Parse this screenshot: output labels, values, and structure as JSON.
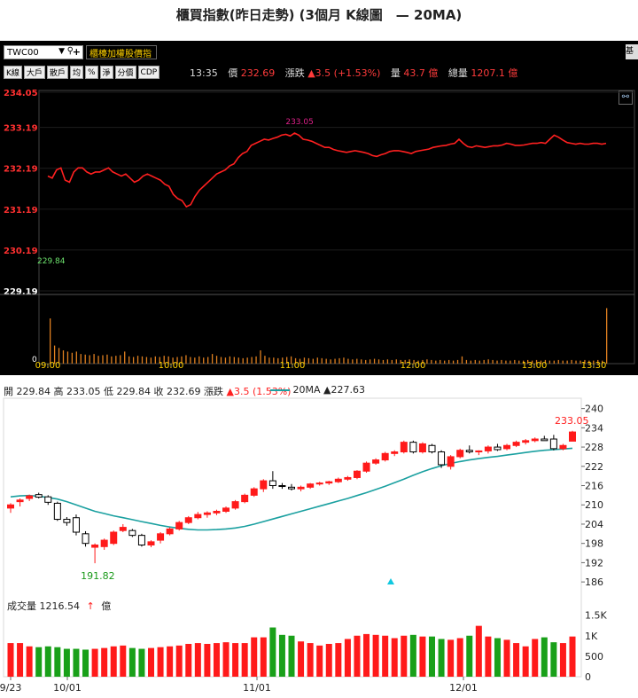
{
  "page_title": "櫃買指數(昨日走勢) (3個月 K線圖　— 20MA)",
  "toolbar": {
    "symbol": "TWC00",
    "index_name": "櫃檯加權股價指",
    "corner_label": "基"
  },
  "tabs": [
    "K線",
    "大戶",
    "散戶",
    "均",
    "%",
    "淨",
    "分價",
    "CDP"
  ],
  "quote": {
    "time": "13:35",
    "price_label": "價",
    "price": "232.69",
    "change_label": "漲跌",
    "change": "▲3.5 (+1.53%)",
    "volume_label": "量",
    "volume": "43.7 億",
    "total_label": "總量",
    "total": "1207.1 億"
  },
  "ohlc": {
    "open_label": "開",
    "open": "229.84",
    "high_label": "高",
    "high": "233.05",
    "low_label": "低",
    "low": "229.84",
    "close_label": "收",
    "close": "232.69",
    "change_label": "漲跌",
    "change": "▲3.5 (1.53%)"
  },
  "ma_legend": {
    "name": "20MA",
    "value": "▲227.63"
  },
  "volume_info": {
    "label": "成交量",
    "value": "1216.54",
    "arrow": "↑",
    "unit": "億"
  },
  "colors": {
    "up": "#ff1a1a",
    "down": "#19a019",
    "ma": "#1aa0a0",
    "intraday_line": "#ff2020",
    "intraday_volume": "#e08020"
  },
  "chart_data": [
    {
      "type": "line",
      "title": "intraday",
      "x_ticks": [
        "09:00",
        "10:00",
        "11:00",
        "12:00",
        "13:00",
        "13:30"
      ],
      "y_ticks": [
        "234.05",
        "233.19",
        "232.19",
        "231.19",
        "230.19",
        "229.19"
      ],
      "ylim": [
        229.19,
        234.05
      ],
      "prev_close_label": "229.84",
      "high_label": "233.05",
      "volume_zero_label": "0",
      "series": [
        {
          "values": [
            232.0,
            231.95,
            232.15,
            232.2,
            231.9,
            231.85,
            232.1,
            232.2,
            232.2,
            232.1,
            232.05,
            232.1,
            232.1,
            232.15,
            232.2,
            232.1,
            232.05,
            232.0,
            232.05,
            231.95,
            231.85,
            231.9,
            232.0,
            232.05,
            232.0,
            231.95,
            231.9,
            231.8,
            231.75,
            231.55,
            231.45,
            231.4,
            231.25,
            231.3,
            231.5,
            231.65,
            231.75,
            231.85,
            231.95,
            232.05,
            232.1,
            232.15,
            232.25,
            232.3,
            232.45,
            232.55,
            232.6,
            232.75,
            232.8,
            232.85,
            232.9,
            232.88,
            232.92,
            232.95,
            233.0,
            233.02,
            232.98,
            233.05,
            233.0,
            232.9,
            232.88,
            232.85,
            232.8,
            232.75,
            232.7,
            232.7,
            232.65,
            232.62,
            232.6,
            232.58,
            232.6,
            232.62,
            232.6,
            232.58,
            232.55,
            232.5,
            232.48,
            232.52,
            232.55,
            232.6,
            232.62,
            232.62,
            232.6,
            232.58,
            232.55,
            232.6,
            232.62,
            232.64,
            232.66,
            232.7,
            232.72,
            232.74,
            232.75,
            232.78,
            232.8,
            232.9,
            232.8,
            232.72,
            232.7,
            232.74,
            232.72,
            232.7,
            232.72,
            232.74,
            232.74,
            232.76,
            232.8,
            232.78,
            232.75,
            232.75,
            232.76,
            232.78,
            232.8,
            232.8,
            232.82,
            232.8,
            232.9,
            233.0,
            232.95,
            232.88,
            232.82,
            232.8,
            232.78,
            232.8,
            232.78,
            232.78,
            232.8,
            232.8,
            232.78,
            232.8
          ]
        }
      ],
      "volume": {
        "open_spike": 0.78,
        "close_spike": 0.92,
        "values": [
          0.75,
          0.3,
          0.26,
          0.22,
          0.2,
          0.18,
          0.2,
          0.16,
          0.15,
          0.14,
          0.16,
          0.13,
          0.14,
          0.15,
          0.12,
          0.13,
          0.14,
          0.2,
          0.12,
          0.11,
          0.13,
          0.12,
          0.11,
          0.1,
          0.12,
          0.11,
          0.13,
          0.12,
          0.1,
          0.11,
          0.12,
          0.14,
          0.11,
          0.1,
          0.12,
          0.1,
          0.11,
          0.16,
          0.13,
          0.11,
          0.1,
          0.12,
          0.11,
          0.1,
          0.09,
          0.1,
          0.11,
          0.12,
          0.22,
          0.13,
          0.1,
          0.1,
          0.09,
          0.1,
          0.11,
          0.12,
          0.09,
          0.08,
          0.1,
          0.09,
          0.08,
          0.1,
          0.09,
          0.08,
          0.07,
          0.08,
          0.09,
          0.1,
          0.08,
          0.07,
          0.08,
          0.07,
          0.06,
          0.07,
          0.08,
          0.07,
          0.06,
          0.07,
          0.06,
          0.07,
          0.06,
          0.06,
          0.07,
          0.06,
          0.05,
          0.06,
          0.07,
          0.06,
          0.05,
          0.06,
          0.05,
          0.06,
          0.05,
          0.06,
          0.12,
          0.06,
          0.05,
          0.06,
          0.05,
          0.06,
          0.07,
          0.06,
          0.05,
          0.06,
          0.05,
          0.05,
          0.06,
          0.05,
          0.05,
          0.06,
          0.05,
          0.06,
          0.05,
          0.06,
          0.05,
          0.05,
          0.06,
          0.05,
          0.05,
          0.06,
          0.05,
          0.05,
          0.06,
          0.05,
          0.05,
          0.06,
          0.05,
          0.92
        ]
      }
    },
    {
      "type": "candlestick",
      "title": "3-month daily K",
      "x_ticks": [
        "9/23",
        "10/01",
        "11/01",
        "12/01"
      ],
      "y_ticks": [
        "240",
        "234",
        "228",
        "222",
        "216",
        "210",
        "204",
        "198",
        "192",
        "186"
      ],
      "ylim": [
        183,
        241
      ],
      "min_label": "191.82",
      "max_label": "233.05",
      "candles": [
        {
          "o": 209.0,
          "h": 210.5,
          "l": 207.5,
          "c": 210.0
        },
        {
          "o": 211.0,
          "h": 212.0,
          "l": 209.5,
          "c": 211.5
        },
        {
          "o": 212.0,
          "h": 213.2,
          "l": 211.2,
          "c": 212.8
        },
        {
          "o": 213.2,
          "h": 213.8,
          "l": 212.0,
          "c": 212.4
        },
        {
          "o": 212.5,
          "h": 213.0,
          "l": 210.0,
          "c": 210.8
        },
        {
          "o": 210.5,
          "h": 211.0,
          "l": 205.0,
          "c": 205.5
        },
        {
          "o": 205.5,
          "h": 206.2,
          "l": 203.5,
          "c": 204.5
        },
        {
          "o": 206.0,
          "h": 207.0,
          "l": 200.5,
          "c": 201.5
        },
        {
          "o": 201.0,
          "h": 201.8,
          "l": 197.0,
          "c": 198.0
        },
        {
          "o": 196.8,
          "h": 198.0,
          "l": 191.82,
          "c": 197.5
        },
        {
          "o": 197.0,
          "h": 199.5,
          "l": 196.0,
          "c": 199.0
        },
        {
          "o": 198.0,
          "h": 202.0,
          "l": 197.5,
          "c": 201.5
        },
        {
          "o": 202.0,
          "h": 204.0,
          "l": 201.5,
          "c": 203.0
        },
        {
          "o": 202.0,
          "h": 202.5,
          "l": 200.0,
          "c": 200.5
        },
        {
          "o": 200.5,
          "h": 201.0,
          "l": 197.0,
          "c": 197.5
        },
        {
          "o": 197.5,
          "h": 199.0,
          "l": 196.8,
          "c": 198.5
        },
        {
          "o": 199.0,
          "h": 201.5,
          "l": 198.0,
          "c": 201.0
        },
        {
          "o": 201.0,
          "h": 203.0,
          "l": 200.5,
          "c": 202.5
        },
        {
          "o": 202.5,
          "h": 205.0,
          "l": 202.0,
          "c": 204.5
        },
        {
          "o": 204.5,
          "h": 206.5,
          "l": 204.0,
          "c": 206.0
        },
        {
          "o": 206.0,
          "h": 207.8,
          "l": 205.5,
          "c": 207.0
        },
        {
          "o": 207.0,
          "h": 208.0,
          "l": 206.0,
          "c": 207.5
        },
        {
          "o": 207.5,
          "h": 208.5,
          "l": 206.8,
          "c": 208.0
        },
        {
          "o": 208.0,
          "h": 209.5,
          "l": 207.5,
          "c": 209.0
        },
        {
          "o": 209.0,
          "h": 211.5,
          "l": 208.5,
          "c": 211.0
        },
        {
          "o": 211.0,
          "h": 213.5,
          "l": 210.5,
          "c": 213.0
        },
        {
          "o": 213.0,
          "h": 215.5,
          "l": 212.5,
          "c": 215.0
        },
        {
          "o": 215.0,
          "h": 218.0,
          "l": 214.0,
          "c": 217.5
        },
        {
          "o": 217.5,
          "h": 220.5,
          "l": 215.0,
          "c": 216.0
        },
        {
          "o": 216.0,
          "h": 216.8,
          "l": 215.0,
          "c": 215.8
        },
        {
          "o": 215.5,
          "h": 216.5,
          "l": 214.5,
          "c": 215.0
        },
        {
          "o": 215.0,
          "h": 216.0,
          "l": 214.2,
          "c": 215.5
        },
        {
          "o": 215.5,
          "h": 216.8,
          "l": 215.0,
          "c": 216.5
        },
        {
          "o": 216.5,
          "h": 217.2,
          "l": 216.0,
          "c": 216.8
        },
        {
          "o": 216.8,
          "h": 217.5,
          "l": 216.2,
          "c": 217.2
        },
        {
          "o": 217.2,
          "h": 218.5,
          "l": 216.8,
          "c": 218.0
        },
        {
          "o": 218.0,
          "h": 219.0,
          "l": 217.5,
          "c": 218.5
        },
        {
          "o": 218.5,
          "h": 220.8,
          "l": 218.0,
          "c": 220.5
        },
        {
          "o": 220.5,
          "h": 223.5,
          "l": 220.0,
          "c": 223.0
        },
        {
          "o": 223.0,
          "h": 224.5,
          "l": 222.5,
          "c": 224.0
        },
        {
          "o": 224.0,
          "h": 226.5,
          "l": 223.5,
          "c": 226.0
        },
        {
          "o": 226.0,
          "h": 227.0,
          "l": 225.2,
          "c": 226.5
        },
        {
          "o": 226.5,
          "h": 230.0,
          "l": 226.0,
          "c": 229.5
        },
        {
          "o": 229.5,
          "h": 230.0,
          "l": 226.0,
          "c": 226.5
        },
        {
          "o": 226.5,
          "h": 229.5,
          "l": 226.0,
          "c": 229.0
        },
        {
          "o": 228.5,
          "h": 229.0,
          "l": 226.0,
          "c": 226.5
        },
        {
          "o": 226.5,
          "h": 227.0,
          "l": 221.5,
          "c": 222.5
        },
        {
          "o": 222.0,
          "h": 225.5,
          "l": 221.0,
          "c": 225.0
        },
        {
          "o": 225.0,
          "h": 227.5,
          "l": 224.5,
          "c": 227.0
        },
        {
          "o": 227.0,
          "h": 228.5,
          "l": 226.0,
          "c": 226.5
        },
        {
          "o": 226.5,
          "h": 227.0,
          "l": 225.5,
          "c": 226.8
        },
        {
          "o": 226.8,
          "h": 228.5,
          "l": 226.0,
          "c": 228.0
        },
        {
          "o": 228.0,
          "h": 229.0,
          "l": 226.8,
          "c": 227.2
        },
        {
          "o": 227.5,
          "h": 229.0,
          "l": 227.0,
          "c": 228.5
        },
        {
          "o": 228.5,
          "h": 230.0,
          "l": 228.0,
          "c": 229.5
        },
        {
          "o": 229.5,
          "h": 230.5,
          "l": 228.8,
          "c": 230.0
        },
        {
          "o": 230.0,
          "h": 231.0,
          "l": 229.5,
          "c": 230.5
        },
        {
          "o": 230.5,
          "h": 231.5,
          "l": 230.0,
          "c": 230.0
        },
        {
          "o": 230.5,
          "h": 231.8,
          "l": 227.0,
          "c": 227.5
        },
        {
          "o": 227.5,
          "h": 229.0,
          "l": 227.0,
          "c": 228.5
        },
        {
          "o": 229.84,
          "h": 233.05,
          "l": 229.84,
          "c": 232.69
        }
      ],
      "ma20": [
        212.5,
        212.8,
        212.9,
        212.7,
        212.3,
        211.8,
        211.0,
        210.0,
        209.0,
        208.0,
        207.3,
        206.6,
        206.0,
        205.4,
        204.8,
        204.2,
        203.6,
        203.1,
        202.7,
        202.4,
        202.2,
        202.2,
        202.3,
        202.5,
        202.8,
        203.3,
        204.0,
        204.8,
        205.6,
        206.4,
        207.2,
        208.0,
        208.8,
        209.6,
        210.4,
        211.2,
        212.0,
        212.9,
        213.8,
        214.8,
        215.8,
        216.9,
        218.0,
        219.2,
        220.3,
        221.3,
        222.2,
        222.9,
        223.5,
        224.0,
        224.4,
        224.8,
        225.1,
        225.5,
        225.9,
        226.3,
        226.7,
        227.0,
        227.2,
        227.4,
        227.63
      ],
      "volume": {
        "ylim": [
          0,
          1.6
        ],
        "y_ticks": [
          "1.5K",
          "1K",
          "500",
          "0"
        ],
        "values": [
          0.82,
          0.82,
          0.74,
          0.72,
          0.74,
          0.72,
          0.68,
          0.68,
          0.66,
          0.68,
          0.7,
          0.74,
          0.76,
          0.7,
          0.68,
          0.7,
          0.72,
          0.74,
          0.76,
          0.8,
          0.82,
          0.8,
          0.82,
          0.84,
          0.82,
          0.82,
          0.96,
          0.96,
          1.2,
          1.02,
          1.0,
          0.86,
          0.82,
          0.76,
          0.8,
          0.82,
          0.92,
          1.0,
          1.04,
          1.02,
          1.0,
          0.94,
          1.0,
          1.02,
          0.98,
          0.98,
          0.92,
          0.9,
          0.94,
          1.0,
          1.24,
          0.98,
          0.94,
          0.9,
          0.82,
          0.74,
          0.92,
          0.96,
          0.84,
          0.82,
          0.98
        ]
      }
    }
  ]
}
